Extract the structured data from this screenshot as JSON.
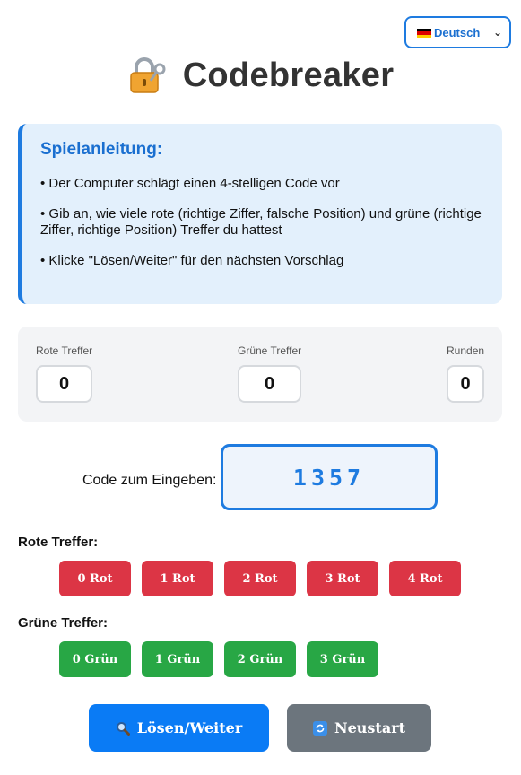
{
  "language": {
    "selected": "Deutsch",
    "flag_icon": "flag-de-icon",
    "colors": [
      "#000000",
      "#dd0000",
      "#ffcc00"
    ]
  },
  "title": "Codebreaker",
  "title_icon": "lock-with-key-icon",
  "instructions": {
    "heading": "Spielanleitung:",
    "items": [
      "• Der Computer schlägt einen 4-stelligen Code vor",
      "• Gib an, wie viele rote (richtige Ziffer, falsche Position) und grüne (richtige Ziffer, richtige Position) Treffer du hattest",
      "• Klicke \"Lösen/Weiter\" für den nächsten Vorschlag"
    ]
  },
  "stats": {
    "red": {
      "label": "Rote Treffer",
      "value": "0"
    },
    "green": {
      "label": "Grüne Treffer",
      "value": "0"
    },
    "rounds": {
      "label": "Runden",
      "value": "0"
    }
  },
  "code": {
    "label": "Code zum Eingeben:",
    "value": "1357"
  },
  "red_section": {
    "label": "Rote Treffer:",
    "buttons": [
      "0 Rot",
      "1 Rot",
      "2 Rot",
      "3 Rot",
      "4 Rot"
    ]
  },
  "green_section": {
    "label": "Grüne Treffer:",
    "buttons": [
      "0 Grün",
      "1 Grün",
      "2 Grün",
      "3 Grün"
    ]
  },
  "actions": {
    "solve": {
      "label": "Lösen/Weiter",
      "icon": "magnifier-icon"
    },
    "restart": {
      "label": "Neustart",
      "icon": "refresh-icon"
    }
  },
  "theme": {
    "accent": "#1e7be0",
    "red": "#dc3545",
    "green": "#28a745",
    "gray": "#6c757d",
    "primary": "#0a7bf5"
  }
}
